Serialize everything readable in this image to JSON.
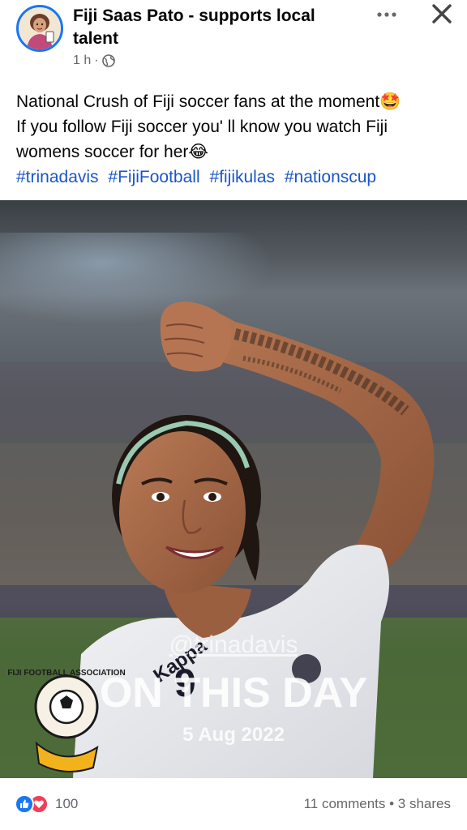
{
  "post": {
    "author": "Fiji Saas Pato - supports local talent",
    "time": "1 h",
    "separator": "·",
    "text_line1": "National Crush of Fiji soccer fans at the moment🤩",
    "text_line2": "If you follow Fiji soccer you' ll know you watch Fiji womens soccer for her😂",
    "hashtags": [
      "#trinadavis",
      "#FijiFootball",
      "#fijikulas",
      "#nationscup"
    ]
  },
  "photo": {
    "overlay_handle": "@trinadavis",
    "overlay_title": "ON THIS DAY",
    "overlay_date": "5 Aug 2022",
    "jersey_number": "9",
    "jersey_brand": "Kappa",
    "logo_text": "FIJI FOOTBALL ASSOCIATION"
  },
  "footer": {
    "reaction_count": "100",
    "comments": "11 comments",
    "dot": "•",
    "shares": "3 shares"
  },
  "icons": {
    "more": "more-options-icon",
    "close": "close-icon",
    "privacy": "globe-icon",
    "like": "like-reaction-icon",
    "love": "love-reaction-icon"
  },
  "colors": {
    "link": "#1a56c8",
    "like": "#1877f2",
    "love": "#f33e58",
    "secondary_text": "#65676b"
  }
}
